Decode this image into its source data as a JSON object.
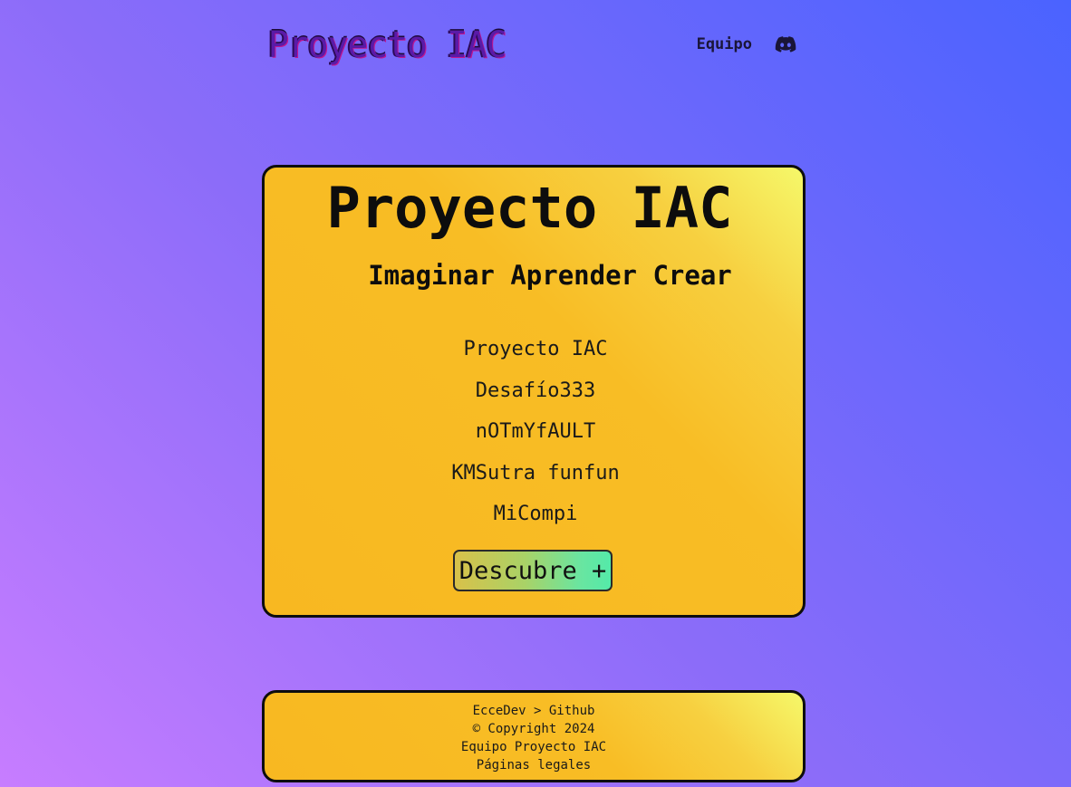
{
  "header": {
    "logo_text": "Proyecto IAC",
    "nav": {
      "team_label": "Equipo",
      "discord_icon": "discord-icon"
    }
  },
  "hero": {
    "title": "Proyecto IAC",
    "subtitle": "Imaginar Aprender Crear",
    "links": [
      "Proyecto IAC",
      "Desafío333",
      "nOTmYfAULT",
      "KMSutra funfun",
      "MiCompi"
    ],
    "cta_label": "Descubre +"
  },
  "footer": {
    "credit": "EcceDev > Github",
    "copyright": "© Copyright 2024",
    "team": "Equipo Proyecto IAC",
    "legal": "Páginas legales"
  },
  "colors": {
    "background_start": "#c77dff",
    "background_end": "#4a63ff",
    "card_yellow": "#f8bd25",
    "card_highlight": "#f5f86a",
    "cta_green": "#54eaa9",
    "logo_purple": "#5a1aa8",
    "discord_navy": "#1a1538"
  }
}
